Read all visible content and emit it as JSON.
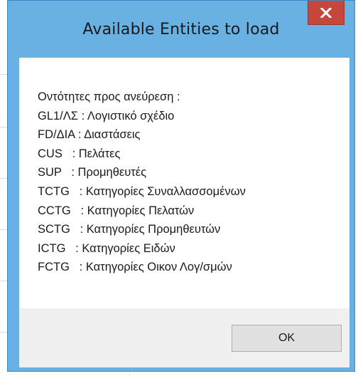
{
  "dialog": {
    "title": "Available Entities to load",
    "close_icon": "close-icon",
    "close_color": "#c6473c",
    "frame_color": "#69b1e3",
    "lines": [
      "Οντότητες προς ανεύρεση :",
      "GL1/ΛΣ : Λογιστικό σχέδιο",
      "FD/ΔΙΑ : Διαστάσεις",
      "CUS   : Πελάτες",
      "SUP   : Προμηθευτές",
      "TCTG   : Κατηγορίες Συναλλασσομένων",
      "CCTG   : Κατηγορίες Πελατών",
      "SCTG   : Κατηγορίες Προμηθευτών",
      "ICTG   : Κατηγορίες Ειδών",
      "FCTG   : Κατηγορίες Οικον Λογ/σμών"
    ],
    "ok_label": "OK"
  }
}
